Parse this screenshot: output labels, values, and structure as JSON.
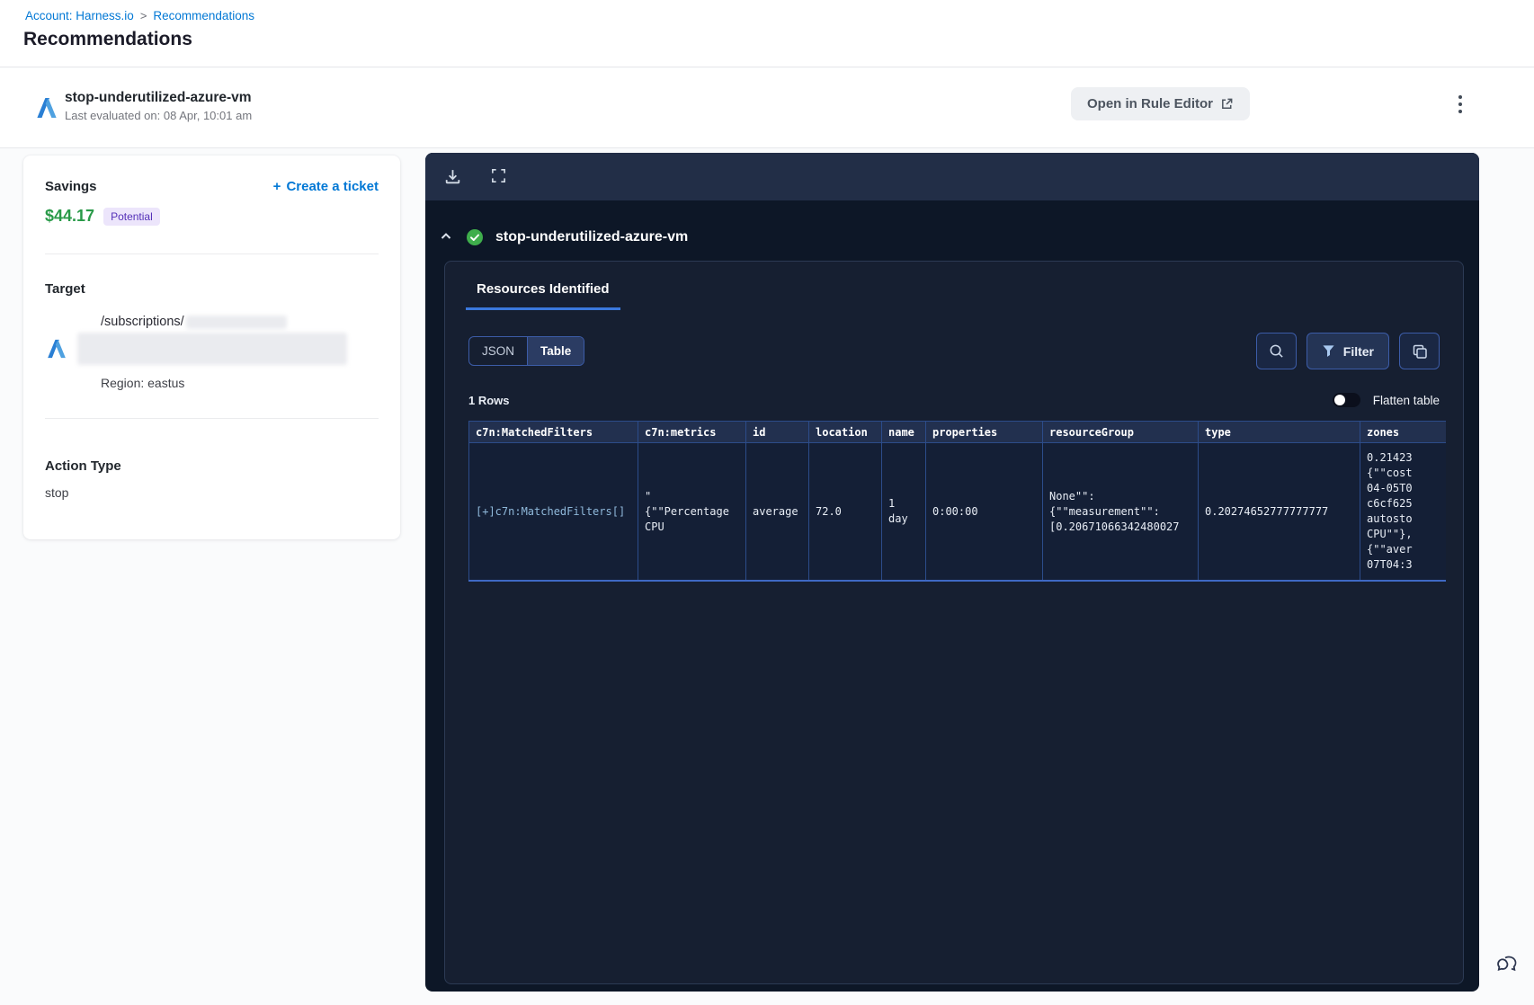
{
  "icons": {
    "plus": "+",
    "breadcrumb_separator": ">"
  },
  "breadcrumb": {
    "account": "Account: Harness.io",
    "current": "Recommendations"
  },
  "page": {
    "title": "Recommendations"
  },
  "header": {
    "title": "stop-underutilized-azure-vm",
    "subtitle": "Last evaluated on: 08 Apr, 10:01 am",
    "open_rule_editor": "Open in Rule Editor"
  },
  "sidebar": {
    "savings_label": "Savings",
    "savings_value": "$44.17",
    "savings_badge": "Potential",
    "create_ticket": "Create a ticket",
    "target_label": "Target",
    "target_path": "/subscriptions/",
    "region": "Region: eastus",
    "action_type_label": "Action Type",
    "action_type_value": "stop"
  },
  "panel": {
    "title": "stop-underutilized-azure-vm",
    "tab": "Resources Identified",
    "view_toggle": {
      "json": "JSON",
      "table": "Table"
    },
    "filter_label": "Filter",
    "rows_count": "1 Rows",
    "flatten_label": "Flatten table",
    "table": {
      "columns": [
        "c7n:MatchedFilters",
        "c7n:metrics",
        "id",
        "location",
        "name",
        "properties",
        "resourceGroup",
        "type",
        "zones"
      ],
      "row": {
        "matched_filters": "[+]c7n:MatchedFilters[]",
        "metrics": "\"\n{\"\"Percentage\nCPU",
        "id": "average",
        "location": "72.0",
        "name": "1 day",
        "properties": "0:00:00",
        "resource_group": "None\"\":\n{\"\"measurement\"\":\n[0.20671066342480027",
        "type": "0.20274652777777777",
        "zones": "0.21423\n{\"\"cost\n04-05T0\nc6cf625\nautosto\nCPU\"\"},\n{\"\"aver\n07T04:3"
      }
    }
  },
  "colors": {
    "link_blue": "#0278d5",
    "savings_green": "#299a48",
    "badge_bg": "#ece5fb",
    "panel_bg": "#0d1727",
    "toolbar_bg": "#222e47",
    "table_border": "#2c4c8a",
    "tab_underline": "#3b78dd",
    "check_green": "#3fae4c"
  }
}
